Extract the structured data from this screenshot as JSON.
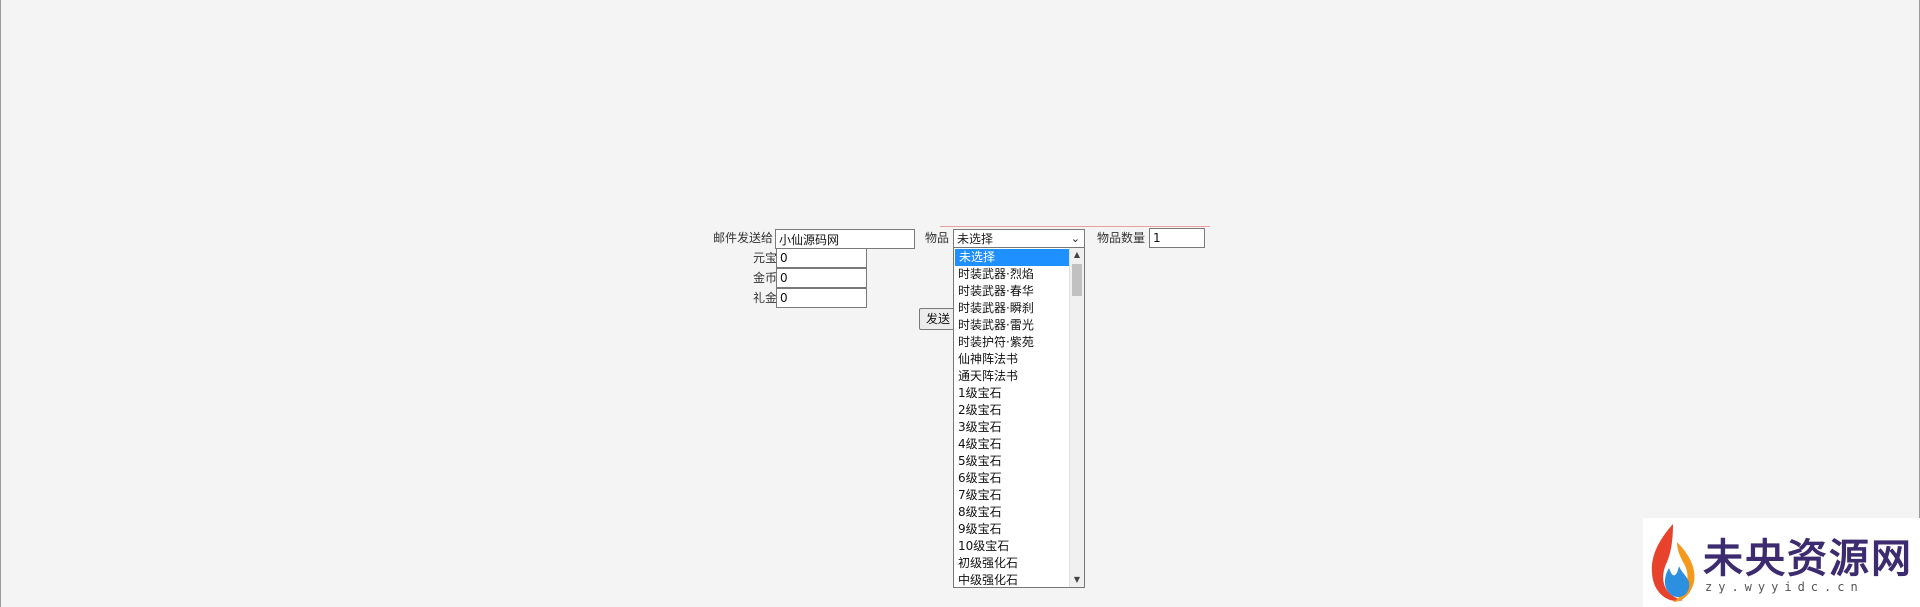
{
  "form": {
    "recipient_label": "邮件发送给",
    "recipient_value": "小仙源码网",
    "item_label": "物品",
    "item_selected": "未选择",
    "quantity_label": "物品数量",
    "quantity_value": "1",
    "yuanbao_label": "元宝",
    "yuanbao_value": "0",
    "gold_label": "金币",
    "gold_value": "0",
    "gift_label": "礼金",
    "gift_value": "0",
    "send_label": "发送"
  },
  "dropdown": {
    "options": [
      "未选择",
      "时装武器·烈焰",
      "时装武器·春华",
      "时装武器·瞬刹",
      "时装武器·雷光",
      "时装护符·紫苑",
      "仙神阵法书",
      "通天阵法书",
      "1级宝石",
      "2级宝石",
      "3级宝石",
      "4级宝石",
      "5级宝石",
      "6级宝石",
      "7级宝石",
      "8级宝石",
      "9级宝石",
      "10级宝石",
      "初级强化石",
      "中级强化石"
    ],
    "selected_index": 0
  },
  "watermark": {
    "title": "未央资源网",
    "url": "zy.wyyidc.cn"
  },
  "colors": {
    "background": "#f4f4f4",
    "selected_option": "#1e90ff",
    "watermark_text": "#3c2b6e"
  }
}
